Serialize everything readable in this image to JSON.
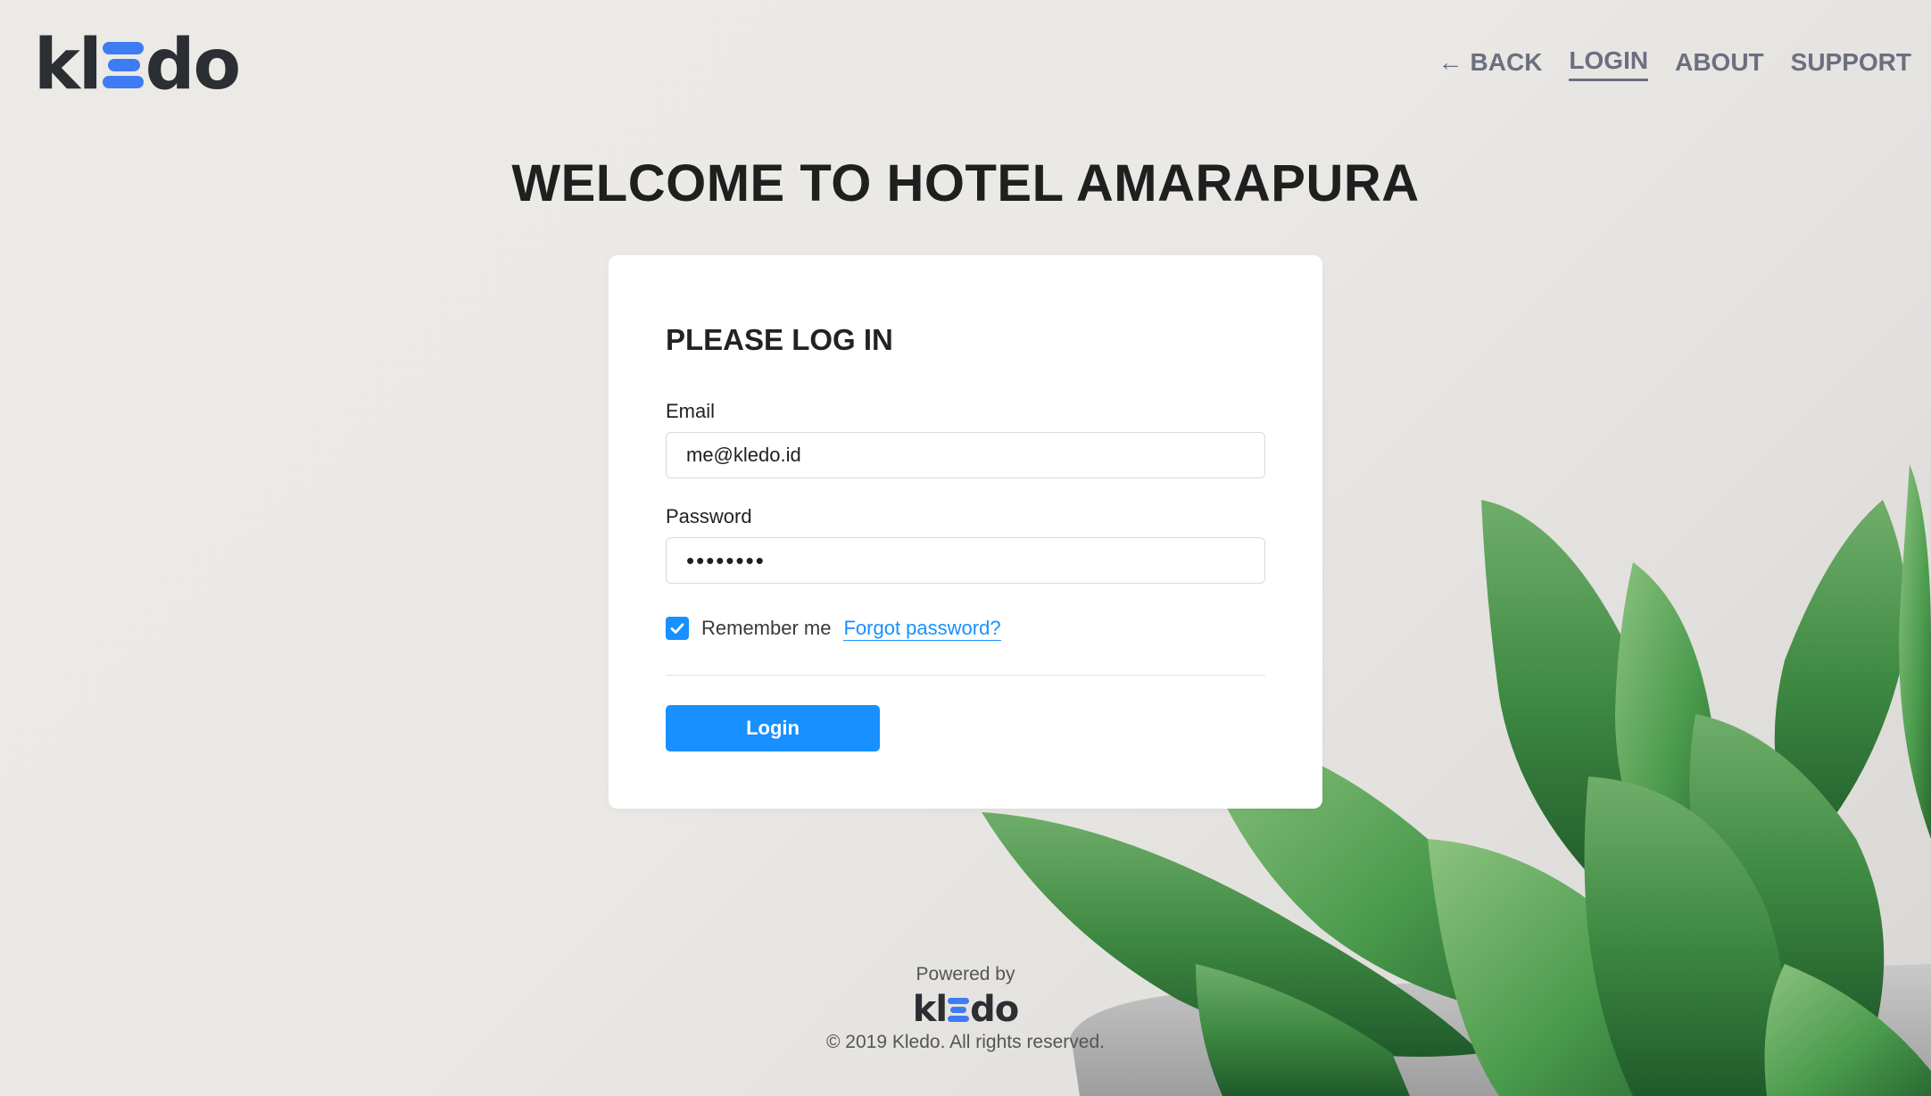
{
  "brand": {
    "logo_prefix": "kl",
    "logo_suffix": "do",
    "accent_color": "#3f7bf3"
  },
  "nav": {
    "back": "BACK",
    "login": "LOGIN",
    "about": "ABOUT",
    "support": "SUPPORT",
    "active": "LOGIN"
  },
  "page_title": "WELCOME TO HOTEL AMARAPURA",
  "login_card": {
    "heading": "PLEASE LOG IN",
    "email_label": "Email",
    "email_value": "me@kledo.id",
    "password_label": "Password",
    "password_value": "••••••••",
    "remember_label": "Remember me",
    "remember_checked": true,
    "forgot_link": "Forgot password?",
    "submit_label": "Login",
    "primary_color": "#1890ff"
  },
  "footer": {
    "powered_by": "Powered by",
    "copyright": "© 2019 Kledo. All rights reserved."
  },
  "icons": {
    "back": "arrow-left-icon",
    "check": "checkmark-icon"
  }
}
